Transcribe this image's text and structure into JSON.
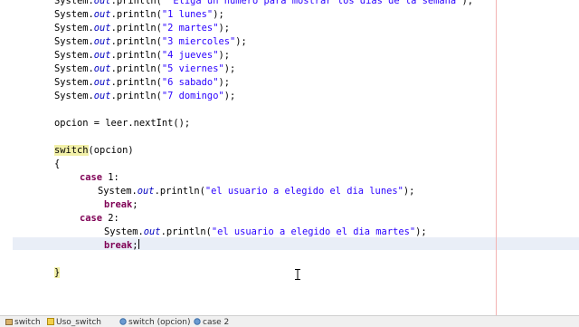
{
  "editor": {
    "lines": [
      {
        "id": "line-print-prompt",
        "parts": [
          [
            "System.",
            "kw"
          ],
          [
            "out",
            "field"
          ],
          [
            ".println(",
            "kw"
          ],
          [
            "\" Eliga un numero para mostrar los dias de la semana\"",
            "str"
          ],
          [
            ");",
            "kw"
          ]
        ]
      },
      {
        "id": "line-print-1",
        "parts": [
          [
            "System.",
            "kw"
          ],
          [
            "out",
            "field"
          ],
          [
            ".println(",
            "kw"
          ],
          [
            "\"1 lunes\"",
            "str"
          ],
          [
            ");",
            "kw"
          ]
        ]
      },
      {
        "id": "line-print-2",
        "parts": [
          [
            "System.",
            "kw"
          ],
          [
            "out",
            "field"
          ],
          [
            ".println(",
            "kw"
          ],
          [
            "\"2 martes\"",
            "str"
          ],
          [
            ");",
            "kw"
          ]
        ]
      },
      {
        "id": "line-print-3",
        "parts": [
          [
            "System.",
            "kw"
          ],
          [
            "out",
            "field"
          ],
          [
            ".println(",
            "kw"
          ],
          [
            "\"3 miercoles\"",
            "str"
          ],
          [
            ");",
            "kw"
          ]
        ]
      },
      {
        "id": "line-print-4",
        "parts": [
          [
            "System.",
            "kw"
          ],
          [
            "out",
            "field"
          ],
          [
            ".println(",
            "kw"
          ],
          [
            "\"4 jueves\"",
            "str"
          ],
          [
            ");",
            "kw"
          ]
        ]
      },
      {
        "id": "line-print-5",
        "parts": [
          [
            "System.",
            "kw"
          ],
          [
            "out",
            "field"
          ],
          [
            ".println(",
            "kw"
          ],
          [
            "\"5 viernes\"",
            "str"
          ],
          [
            ");",
            "kw"
          ]
        ]
      },
      {
        "id": "line-print-6",
        "parts": [
          [
            "System.",
            "kw"
          ],
          [
            "out",
            "field"
          ],
          [
            ".println(",
            "kw"
          ],
          [
            "\"6 sabado\"",
            "str"
          ],
          [
            ");",
            "kw"
          ]
        ]
      },
      {
        "id": "line-print-7",
        "parts": [
          [
            "System.",
            "kw"
          ],
          [
            "out",
            "field"
          ],
          [
            ".println(",
            "kw"
          ],
          [
            "\"7 domingo\"",
            "str"
          ],
          [
            ");",
            "kw"
          ]
        ]
      },
      {
        "id": "line-blank-1",
        "parts": []
      },
      {
        "id": "line-assign",
        "parts": [
          [
            "opcion = leer.nextInt();",
            "kw"
          ]
        ]
      },
      {
        "id": "line-blank-2",
        "parts": []
      },
      {
        "id": "line-switch",
        "parts": [
          [
            "switch",
            "switch-hl"
          ],
          [
            "(opcion)",
            "kw"
          ]
        ]
      },
      {
        "id": "line-open-brace",
        "parts": [
          [
            "{",
            "kw"
          ]
        ]
      },
      {
        "id": "line-case-1",
        "parts": [
          [
            "case",
            "keyword"
          ],
          [
            " 1:",
            "kw"
          ]
        ]
      },
      {
        "id": "line-case1-print",
        "parts": [
          [
            "System.",
            "kw"
          ],
          [
            "out",
            "field"
          ],
          [
            ".println(",
            "kw"
          ],
          [
            "\"el usuario a elegido el dia lunes\"",
            "str"
          ],
          [
            ");",
            "kw"
          ]
        ]
      },
      {
        "id": "line-case1-break",
        "parts": [
          [
            "break",
            "keyword"
          ],
          [
            ";",
            "kw"
          ]
        ]
      },
      {
        "id": "line-case-2",
        "parts": [
          [
            "case",
            "keyword"
          ],
          [
            " 2:",
            "kw"
          ]
        ]
      },
      {
        "id": "line-case2-print",
        "parts": [
          [
            "System.",
            "kw"
          ],
          [
            "out",
            "field"
          ],
          [
            ".println(",
            "kw"
          ],
          [
            "\"el usuario a elegido el dia martes\"",
            "str"
          ],
          [
            ");",
            "kw"
          ]
        ]
      },
      {
        "id": "line-case2-break",
        "parts": [
          [
            "break",
            "keyword"
          ],
          [
            ";",
            "kw"
          ]
        ],
        "caret": true
      },
      {
        "id": "line-blank-3",
        "parts": []
      },
      {
        "id": "line-close-brace",
        "parts": [
          [
            "}",
            "brace-hl"
          ]
        ]
      }
    ]
  },
  "breadcrumb": {
    "items": [
      {
        "label": "switch",
        "icon_color": "#8a6d3b"
      },
      {
        "label": "Uso_switch",
        "icon_color": "#c9a227"
      },
      {
        "label": "switch (opcion)",
        "icon_color": "#3b6ea8"
      },
      {
        "label": "case 2",
        "icon_color": "#3b6ea8"
      }
    ]
  },
  "colors": {
    "keyword": "#7f0055",
    "string": "#2a00ff",
    "field": "#0000c0",
    "current_line": "#e9eef7",
    "margin": "#f3b2b2"
  }
}
